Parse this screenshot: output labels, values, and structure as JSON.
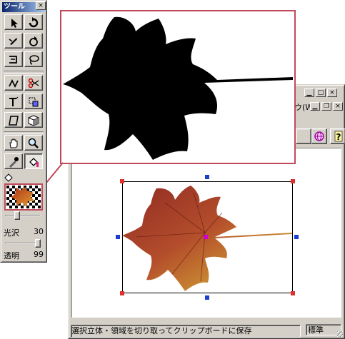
{
  "tool_window": {
    "title": "ツール",
    "close_glyph": "×",
    "gloss_label": "光沢",
    "gloss_value": "30",
    "opacity_label": "透明",
    "opacity_value": "99",
    "gloss_level": 0.3,
    "opacity_level": 0.99
  },
  "doc_window": {
    "menu_text": "ウ(W)",
    "status_text": "選択立体・領域を切り取ってクリップボードに保存",
    "status_mode": "標準"
  },
  "colors": {
    "accent_line": "#c04a5a",
    "handle_corner": "#e03030",
    "handle_side": "#1a3fd0",
    "title_bar": "#0a246a"
  },
  "icons": {
    "tools": [
      "arrow-icon",
      "rotate-icon",
      "knife-icon",
      "lasso-rotate-icon",
      "extrude-icon",
      "lasso-icon",
      "node-icon",
      "scissors-icon",
      "text-3d-icon",
      "group-icon",
      "plane-icon",
      "cube-icon",
      "hand-icon",
      "zoom-icon",
      "eyedropper-icon",
      "paint-bucket-icon"
    ]
  }
}
